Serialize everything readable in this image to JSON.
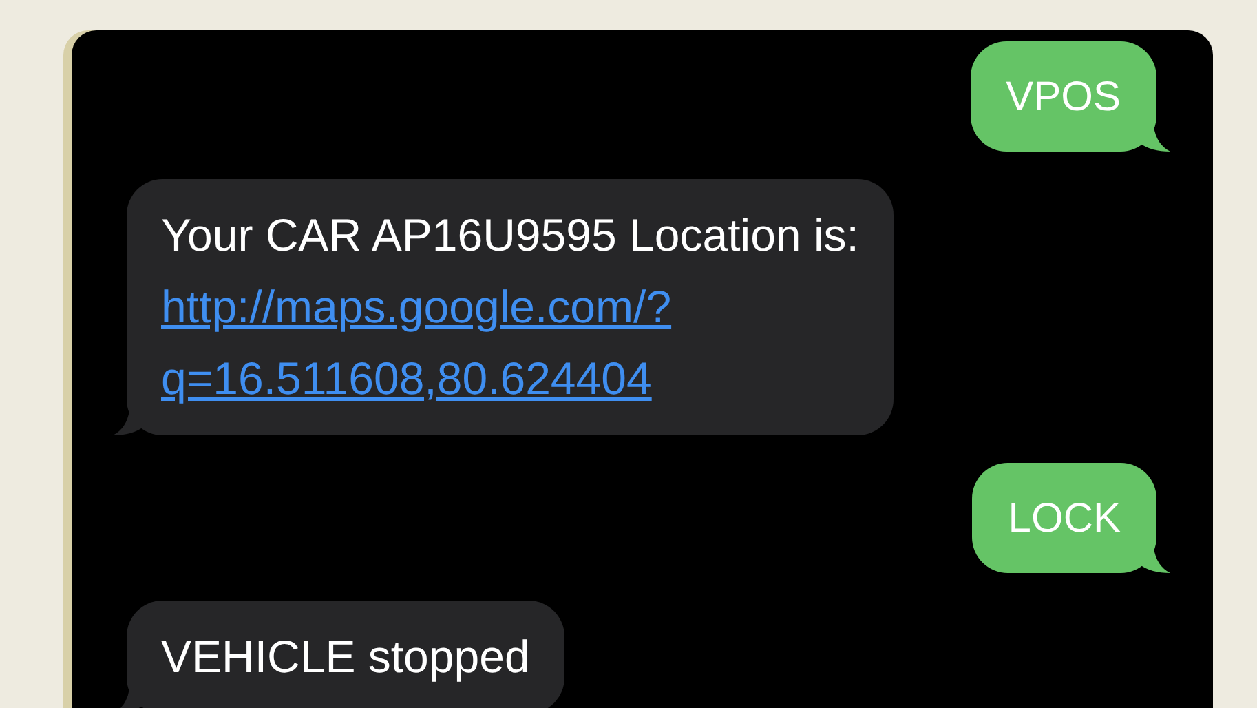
{
  "messages": [
    {
      "kind": "sent",
      "text": "VPOS"
    },
    {
      "kind": "received",
      "text": "Your CAR AP16U9595 Location is:",
      "link_lines": [
        "http://maps.google.com/?",
        "q=16.511608,80.624404"
      ]
    },
    {
      "kind": "sent",
      "text": "LOCK"
    },
    {
      "kind": "received",
      "text": "VEHICLE stopped"
    }
  ]
}
